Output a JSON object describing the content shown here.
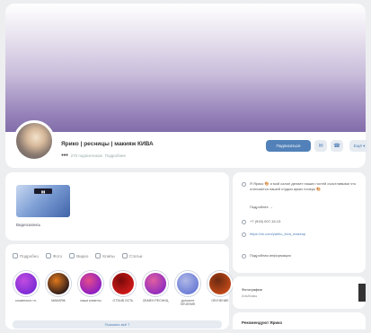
{
  "profile": {
    "name": "Ярико | ресницы | макияж КИВА",
    "status_dots": "●●●",
    "followers": "270 подписчиков",
    "extra": "Подробнее",
    "subscribe_label": "Подписаться",
    "message_icon": "chat-icon",
    "call_icon": "phone-icon",
    "more_label": "Ещё ▾"
  },
  "video": {
    "caption": "Видеозапись"
  },
  "tabs": [
    {
      "label": "Подробно",
      "icon": "info-icon"
    },
    {
      "label": "Фото",
      "icon": "photo-icon"
    },
    {
      "label": "Видео",
      "icon": "video-icon"
    },
    {
      "label": "Клипы",
      "icon": "clip-icon"
    },
    {
      "label": "Статьи",
      "icon": "article-icon"
    }
  ],
  "stories": [
    {
      "label": "косметолог гн.",
      "color_a": "#7a2bd6",
      "color_b": "#c24ce0"
    },
    {
      "label": "МАКИЯЖ",
      "color_a": "#2a1a1a",
      "color_b": "#e0781c"
    },
    {
      "label": "наши клиенты",
      "color_a": "#8a1cc4",
      "color_b": "#e44d8a"
    },
    {
      "label": "ОТЗЫВ ОСТЬ",
      "color_a": "#d11a1a",
      "color_b": "#7a0a0a"
    },
    {
      "label": "ОБМЕН РЕСНИЦ",
      "color_a": "#8e2bbf",
      "color_b": "#e05fa0"
    },
    {
      "label": "до/после ЛЕЧЕНИЕ",
      "color_a": "#6a7bd6",
      "color_b": "#b0b8e6"
    },
    {
      "label": "ОБУЧЕНИЕ",
      "color_a": "#c44a1a",
      "color_b": "#6a2a10"
    }
  ],
  "show_all_label": "Показать всё 7",
  "info": {
    "about": "Я Ярико 🎨 и мой салон делает наших гостей счастливыми что отличается нашей студии ярких почерк 🎨",
    "more_link": "Подробнее →",
    "phone": "+7 (915) 007-15-13",
    "site": "https://vk.com/yariko_kiva_makeup",
    "address": "Подробная информация"
  },
  "gallery": {
    "title": "Фотографии",
    "sub": "Альбомы"
  },
  "recommend": {
    "title": "Рекомендуют Ярико"
  }
}
